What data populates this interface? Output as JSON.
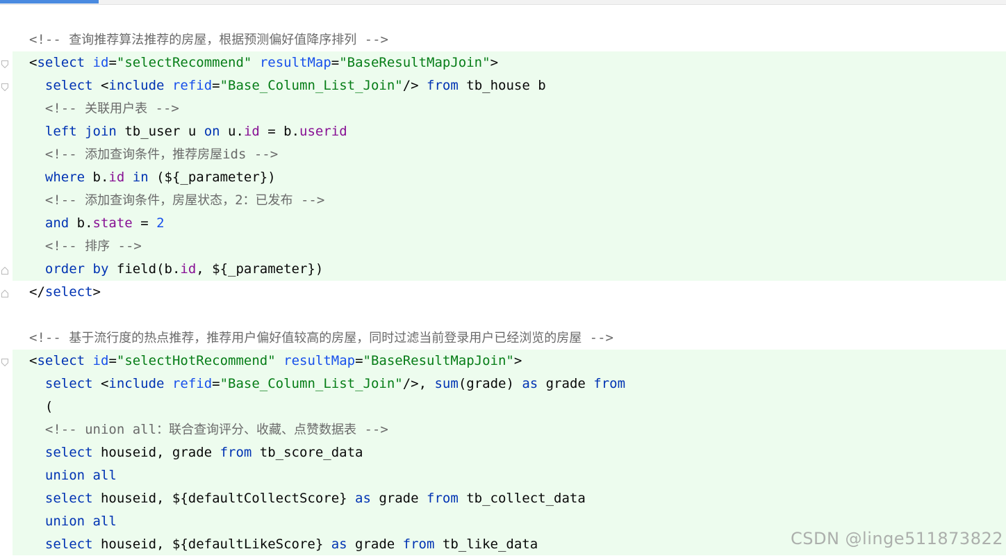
{
  "editor": {
    "lines": [
      [
        {
          "t": "<!-- ",
          "c": "c"
        },
        {
          "t": "查询推荐算法推荐的房屋，根据预测偏好值降序排列",
          "c": "cz"
        },
        {
          "t": " -->",
          "c": "c"
        }
      ],
      [
        {
          "t": "<",
          "c": ""
        },
        {
          "t": "select",
          "c": "t"
        },
        {
          "t": " ",
          "c": ""
        },
        {
          "t": "id",
          "c": "n"
        },
        {
          "t": "=",
          "c": ""
        },
        {
          "t": "\"selectRecommend\"",
          "c": "s"
        },
        {
          "t": " ",
          "c": ""
        },
        {
          "t": "resultMap",
          "c": "n"
        },
        {
          "t": "=",
          "c": ""
        },
        {
          "t": "\"BaseResultMapJoin\"",
          "c": "s"
        },
        {
          "t": ">",
          "c": ""
        }
      ],
      [
        {
          "t": "  ",
          "c": ""
        },
        {
          "t": "select",
          "c": "k"
        },
        {
          "t": " <",
          "c": ""
        },
        {
          "t": "include",
          "c": "t"
        },
        {
          "t": " ",
          "c": ""
        },
        {
          "t": "refid",
          "c": "n"
        },
        {
          "t": "=",
          "c": ""
        },
        {
          "t": "\"Base_Column_List_Join\"",
          "c": "s"
        },
        {
          "t": "/> ",
          "c": ""
        },
        {
          "t": "from",
          "c": "k"
        },
        {
          "t": " tb_house b",
          "c": ""
        }
      ],
      [
        {
          "t": "  <!-- ",
          "c": "c"
        },
        {
          "t": "关联用户表",
          "c": "cz"
        },
        {
          "t": " -->",
          "c": "c"
        }
      ],
      [
        {
          "t": "  ",
          "c": ""
        },
        {
          "t": "left",
          "c": "k"
        },
        {
          "t": " ",
          "c": ""
        },
        {
          "t": "join",
          "c": "k"
        },
        {
          "t": " tb_user u ",
          "c": ""
        },
        {
          "t": "on",
          "c": "k"
        },
        {
          "t": " u.",
          "c": ""
        },
        {
          "t": "id",
          "c": "f"
        },
        {
          "t": " = b.",
          "c": ""
        },
        {
          "t": "userid",
          "c": "f"
        }
      ],
      [
        {
          "t": "  <!-- ",
          "c": "c"
        },
        {
          "t": "添加查询条件，推荐房屋",
          "c": "cz"
        },
        {
          "t": "ids -->",
          "c": "c"
        }
      ],
      [
        {
          "t": "  ",
          "c": ""
        },
        {
          "t": "where",
          "c": "k"
        },
        {
          "t": " b.",
          "c": ""
        },
        {
          "t": "id",
          "c": "f"
        },
        {
          "t": " ",
          "c": ""
        },
        {
          "t": "in",
          "c": "k"
        },
        {
          "t": " (${_parameter})",
          "c": ""
        }
      ],
      [
        {
          "t": "  <!-- ",
          "c": "c"
        },
        {
          "t": "添加查询条件，房屋状态，",
          "c": "cz"
        },
        {
          "t": "2",
          "c": "c"
        },
        {
          "t": "：已发布",
          "c": "cz"
        },
        {
          "t": " -->",
          "c": "c"
        }
      ],
      [
        {
          "t": "  ",
          "c": ""
        },
        {
          "t": "and",
          "c": "k"
        },
        {
          "t": " b.",
          "c": ""
        },
        {
          "t": "state",
          "c": "f"
        },
        {
          "t": " = ",
          "c": ""
        },
        {
          "t": "2",
          "c": "n"
        }
      ],
      [
        {
          "t": "  <!-- ",
          "c": "c"
        },
        {
          "t": "排序",
          "c": "cz"
        },
        {
          "t": " -->",
          "c": "c"
        }
      ],
      [
        {
          "t": "  ",
          "c": ""
        },
        {
          "t": "order",
          "c": "k"
        },
        {
          "t": " ",
          "c": ""
        },
        {
          "t": "by",
          "c": "k"
        },
        {
          "t": " field(b.",
          "c": ""
        },
        {
          "t": "id",
          "c": "f"
        },
        {
          "t": ", ${_parameter})",
          "c": ""
        }
      ],
      [
        {
          "t": "</",
          "c": ""
        },
        {
          "t": "select",
          "c": "t"
        },
        {
          "t": ">",
          "c": ""
        }
      ],
      [],
      [
        {
          "t": "<!-- ",
          "c": "c"
        },
        {
          "t": "基于流行度的热点推荐，推荐用户偏好值较高的房屋，同时过滤当前登录用户已经浏览的房屋",
          "c": "cz"
        },
        {
          "t": " -->",
          "c": "c"
        }
      ],
      [
        {
          "t": "<",
          "c": ""
        },
        {
          "t": "select",
          "c": "t"
        },
        {
          "t": " ",
          "c": ""
        },
        {
          "t": "id",
          "c": "n"
        },
        {
          "t": "=",
          "c": ""
        },
        {
          "t": "\"selectHotRecommend\"",
          "c": "s"
        },
        {
          "t": " ",
          "c": ""
        },
        {
          "t": "resultMap",
          "c": "n"
        },
        {
          "t": "=",
          "c": ""
        },
        {
          "t": "\"BaseResultMapJoin\"",
          "c": "s"
        },
        {
          "t": ">",
          "c": ""
        }
      ],
      [
        {
          "t": "  ",
          "c": ""
        },
        {
          "t": "select",
          "c": "k"
        },
        {
          "t": " <",
          "c": ""
        },
        {
          "t": "include",
          "c": "t"
        },
        {
          "t": " ",
          "c": ""
        },
        {
          "t": "refid",
          "c": "n"
        },
        {
          "t": "=",
          "c": ""
        },
        {
          "t": "\"Base_Column_List_Join\"",
          "c": "s"
        },
        {
          "t": "/>, ",
          "c": ""
        },
        {
          "t": "sum",
          "c": "k"
        },
        {
          "t": "(grade) ",
          "c": ""
        },
        {
          "t": "as",
          "c": "k"
        },
        {
          "t": " grade ",
          "c": ""
        },
        {
          "t": "from",
          "c": "k"
        }
      ],
      [
        {
          "t": "  (",
          "c": ""
        }
      ],
      [
        {
          "t": "  <!-- union all",
          "c": "c"
        },
        {
          "t": "：联合查询评分、收藏、点赞数据表",
          "c": "cz"
        },
        {
          "t": " -->",
          "c": "c"
        }
      ],
      [
        {
          "t": "  ",
          "c": ""
        },
        {
          "t": "select",
          "c": "k"
        },
        {
          "t": " houseid, grade ",
          "c": ""
        },
        {
          "t": "from",
          "c": "k"
        },
        {
          "t": " tb_score_data",
          "c": ""
        }
      ],
      [
        {
          "t": "  ",
          "c": ""
        },
        {
          "t": "union",
          "c": "k"
        },
        {
          "t": " ",
          "c": ""
        },
        {
          "t": "all",
          "c": "k"
        }
      ],
      [
        {
          "t": "  ",
          "c": ""
        },
        {
          "t": "select",
          "c": "k"
        },
        {
          "t": " houseid, ${defaultCollectScore} ",
          "c": ""
        },
        {
          "t": "as",
          "c": "k"
        },
        {
          "t": " grade ",
          "c": ""
        },
        {
          "t": "from",
          "c": "k"
        },
        {
          "t": " tb_collect_data",
          "c": ""
        }
      ],
      [
        {
          "t": "  ",
          "c": ""
        },
        {
          "t": "union",
          "c": "k"
        },
        {
          "t": " ",
          "c": ""
        },
        {
          "t": "all",
          "c": "k"
        }
      ],
      [
        {
          "t": "  ",
          "c": ""
        },
        {
          "t": "select",
          "c": "k"
        },
        {
          "t": " houseid, ${defaultLikeScore} ",
          "c": ""
        },
        {
          "t": "as",
          "c": "k"
        },
        {
          "t": " grade ",
          "c": ""
        },
        {
          "t": "from",
          "c": "k"
        },
        {
          "t": " tb_like_data",
          "c": ""
        }
      ]
    ]
  },
  "watermark": "CSDN @linge511873822",
  "colors": {
    "background": "#ffffff",
    "highlight_block": "#edfcee",
    "comment": "#6a6a6a",
    "keyword": "#0033b3",
    "string": "#067d17",
    "attribute": "#1750eb",
    "field": "#871094",
    "tab_accent": "#4a8ae0"
  }
}
